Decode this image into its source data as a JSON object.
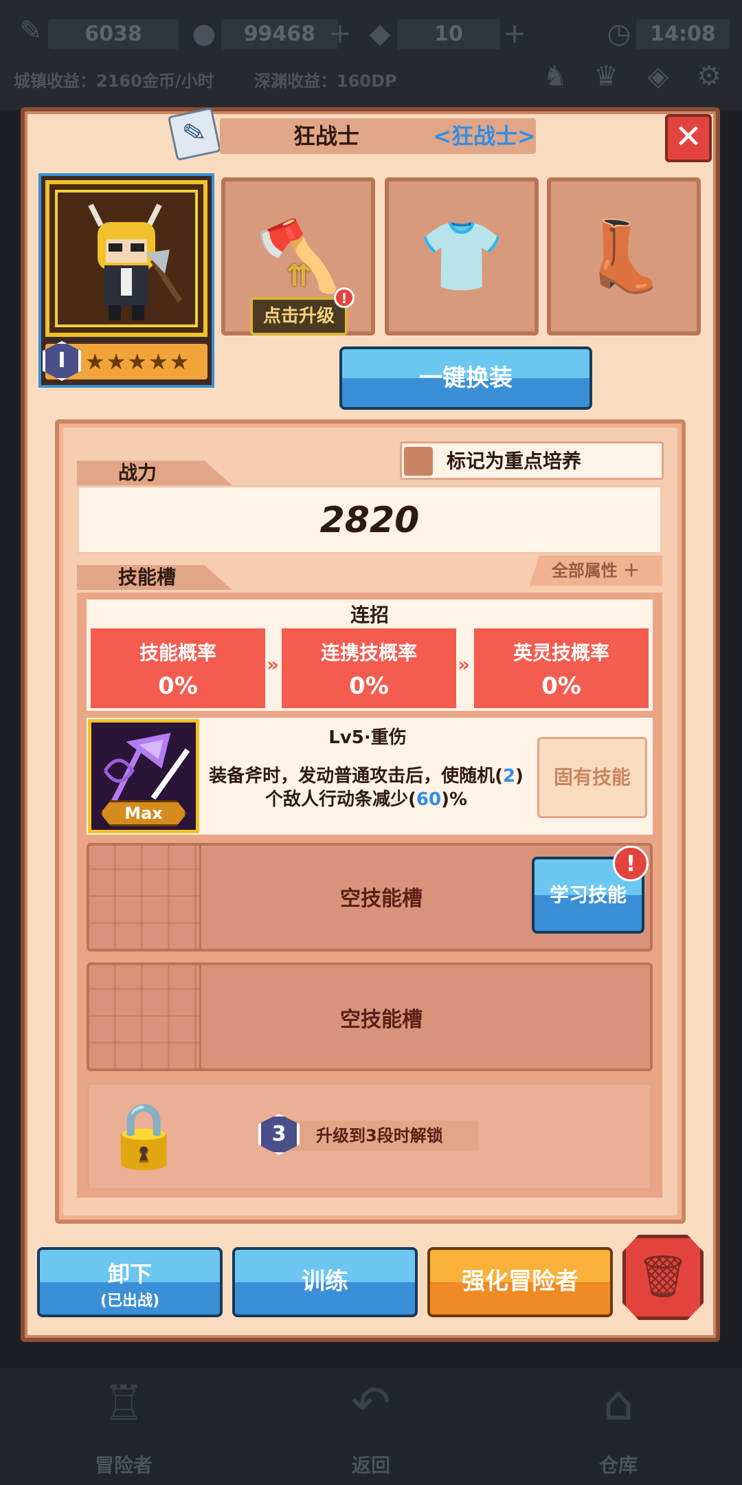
{
  "topbar": {
    "energy": "6038",
    "gold": "99468",
    "gems": "10",
    "time": "14:08",
    "town_income": "城镇收益：2160金币/小时",
    "abyss_income": "深渊收益：160DP"
  },
  "header": {
    "title": "狂战士",
    "class_tag": "<狂战士>",
    "close_label": "✕"
  },
  "portrait": {
    "rank": "I",
    "stars": "★★★★★"
  },
  "equipment": {
    "upgrade_label": "点击升级",
    "badge": "!",
    "one_click_label": "一键换装"
  },
  "stats": {
    "mark_label": "标记为重点培养",
    "power_tab": "战力",
    "power": "2820",
    "skills_tab": "技能槽",
    "all_attributes": "全部属性 ＋"
  },
  "combo": {
    "title": "连招",
    "items": [
      {
        "label": "技能概率",
        "value": "0%"
      },
      {
        "label": "连携技概率",
        "value": "0%"
      },
      {
        "label": "英灵技概率",
        "value": "0%"
      }
    ]
  },
  "skill": {
    "name": "Lv5·重伤",
    "desc_a": "装备斧时，发动普通攻击后，使随机(",
    "desc_b": "2",
    "desc_c": ")个敌人行动条减少(",
    "desc_d": "60",
    "desc_e": ")%",
    "max": "Max",
    "innate": "固有技能"
  },
  "slots": {
    "empty1": "空技能槽",
    "learn": "学习技能",
    "learn_badge": "!",
    "empty2": "空技能槽",
    "lock_level": "3",
    "lock_text": "升级到3段时解锁"
  },
  "actions": {
    "unequip": "卸下",
    "unequip_sub": "(已出战)",
    "train": "训练",
    "enhance": "强化冒险者",
    "trash_icon": "trash-icon"
  },
  "nav": {
    "adventurers": "冒险者",
    "back": "返回",
    "warehouse": "仓库"
  },
  "colors": {
    "accent_blue": "#3a8fd6",
    "combo_red": "#f45c4f",
    "enhance_orange": "#f08a24",
    "panel_bg": "#f9dcc0"
  }
}
